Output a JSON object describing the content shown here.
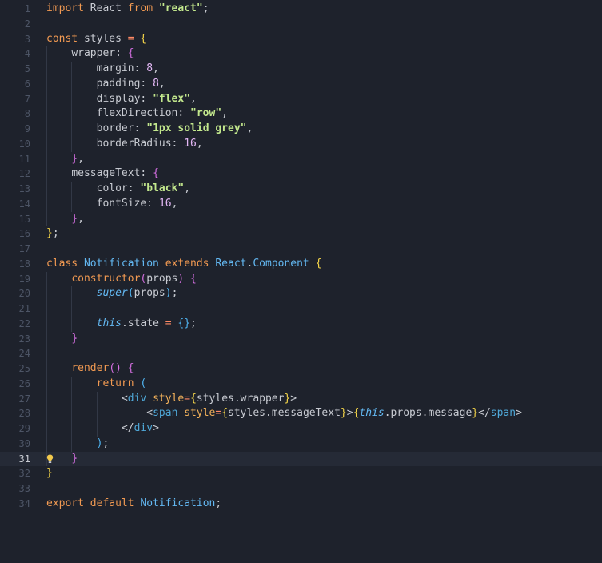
{
  "editor": {
    "current_line": 31,
    "lines": [
      {
        "n": "1",
        "indent": 0,
        "tokens": [
          [
            "kw",
            "import"
          ],
          [
            "plain",
            " React "
          ],
          [
            "kw",
            "from"
          ],
          [
            "plain",
            " "
          ],
          [
            "str",
            "\"react\""
          ],
          [
            "plain",
            ";"
          ]
        ]
      },
      {
        "n": "2",
        "indent": 0,
        "tokens": []
      },
      {
        "n": "3",
        "indent": 0,
        "tokens": [
          [
            "kw",
            "const"
          ],
          [
            "plain",
            " styles "
          ],
          [
            "op",
            "="
          ],
          [
            "plain",
            " "
          ],
          [
            "b1",
            "{"
          ]
        ]
      },
      {
        "n": "4",
        "indent": 1,
        "tokens": [
          [
            "plain",
            "wrapper"
          ],
          [
            "plain",
            ": "
          ],
          [
            "b2",
            "{"
          ]
        ]
      },
      {
        "n": "5",
        "indent": 2,
        "tokens": [
          [
            "plain",
            "margin"
          ],
          [
            "plain",
            ": "
          ],
          [
            "num",
            "8"
          ],
          [
            "plain",
            ","
          ]
        ]
      },
      {
        "n": "6",
        "indent": 2,
        "tokens": [
          [
            "plain",
            "padding"
          ],
          [
            "plain",
            ": "
          ],
          [
            "num",
            "8"
          ],
          [
            "plain",
            ","
          ]
        ]
      },
      {
        "n": "7",
        "indent": 2,
        "tokens": [
          [
            "plain",
            "display"
          ],
          [
            "plain",
            ": "
          ],
          [
            "str",
            "\"flex\""
          ],
          [
            "plain",
            ","
          ]
        ]
      },
      {
        "n": "8",
        "indent": 2,
        "tokens": [
          [
            "plain",
            "flexDirection"
          ],
          [
            "plain",
            ": "
          ],
          [
            "str",
            "\"row\""
          ],
          [
            "plain",
            ","
          ]
        ]
      },
      {
        "n": "9",
        "indent": 2,
        "tokens": [
          [
            "plain",
            "border"
          ],
          [
            "plain",
            ": "
          ],
          [
            "str",
            "\"1px solid grey\""
          ],
          [
            "plain",
            ","
          ]
        ]
      },
      {
        "n": "10",
        "indent": 2,
        "tokens": [
          [
            "plain",
            "borderRadius"
          ],
          [
            "plain",
            ": "
          ],
          [
            "num",
            "16"
          ],
          [
            "plain",
            ","
          ]
        ]
      },
      {
        "n": "11",
        "indent": 1,
        "tokens": [
          [
            "b2",
            "}"
          ],
          [
            "plain",
            ","
          ]
        ]
      },
      {
        "n": "12",
        "indent": 1,
        "tokens": [
          [
            "plain",
            "messageText"
          ],
          [
            "plain",
            ": "
          ],
          [
            "b2",
            "{"
          ]
        ]
      },
      {
        "n": "13",
        "indent": 2,
        "tokens": [
          [
            "plain",
            "color"
          ],
          [
            "plain",
            ": "
          ],
          [
            "str",
            "\"black\""
          ],
          [
            "plain",
            ","
          ]
        ]
      },
      {
        "n": "14",
        "indent": 2,
        "tokens": [
          [
            "plain",
            "fontSize"
          ],
          [
            "plain",
            ": "
          ],
          [
            "num",
            "16"
          ],
          [
            "plain",
            ","
          ]
        ]
      },
      {
        "n": "15",
        "indent": 1,
        "tokens": [
          [
            "b2",
            "}"
          ],
          [
            "plain",
            ","
          ]
        ]
      },
      {
        "n": "16",
        "indent": 0,
        "tokens": [
          [
            "b1",
            "}"
          ],
          [
            "plain",
            ";"
          ]
        ]
      },
      {
        "n": "17",
        "indent": 0,
        "tokens": []
      },
      {
        "n": "18",
        "indent": 0,
        "tokens": [
          [
            "kw",
            "class"
          ],
          [
            "plain",
            " "
          ],
          [
            "cls",
            "Notification"
          ],
          [
            "plain",
            " "
          ],
          [
            "kw",
            "extends"
          ],
          [
            "plain",
            " "
          ],
          [
            "cls",
            "React"
          ],
          [
            "plain",
            "."
          ],
          [
            "cls",
            "Component"
          ],
          [
            "plain",
            " "
          ],
          [
            "b1",
            "{"
          ]
        ]
      },
      {
        "n": "19",
        "indent": 1,
        "tokens": [
          [
            "method",
            "constructor"
          ],
          [
            "b2",
            "("
          ],
          [
            "plain",
            "props"
          ],
          [
            "b2",
            ")"
          ],
          [
            "plain",
            " "
          ],
          [
            "b2",
            "{"
          ]
        ]
      },
      {
        "n": "20",
        "indent": 2,
        "tokens": [
          [
            "ital",
            "super"
          ],
          [
            "b3",
            "("
          ],
          [
            "plain",
            "props"
          ],
          [
            "b3",
            ")"
          ],
          [
            "plain",
            ";"
          ]
        ]
      },
      {
        "n": "21",
        "indent": 2,
        "tokens": []
      },
      {
        "n": "22",
        "indent": 2,
        "tokens": [
          [
            "ital",
            "this"
          ],
          [
            "plain",
            ".state "
          ],
          [
            "op",
            "="
          ],
          [
            "plain",
            " "
          ],
          [
            "b3",
            "{}"
          ],
          [
            "plain",
            ";"
          ]
        ]
      },
      {
        "n": "23",
        "indent": 1,
        "tokens": [
          [
            "b2",
            "}"
          ]
        ]
      },
      {
        "n": "24",
        "indent": 1,
        "tokens": []
      },
      {
        "n": "25",
        "indent": 1,
        "tokens": [
          [
            "method",
            "render"
          ],
          [
            "b2",
            "()"
          ],
          [
            "plain",
            " "
          ],
          [
            "b2",
            "{"
          ]
        ]
      },
      {
        "n": "26",
        "indent": 2,
        "tokens": [
          [
            "kw",
            "return"
          ],
          [
            "plain",
            " "
          ],
          [
            "b3",
            "("
          ]
        ]
      },
      {
        "n": "27",
        "indent": 3,
        "tokens": [
          [
            "punc",
            "<"
          ],
          [
            "tag",
            "div"
          ],
          [
            "plain",
            " "
          ],
          [
            "attr",
            "style"
          ],
          [
            "op",
            "="
          ],
          [
            "b1",
            "{"
          ],
          [
            "plain",
            "styles.wrapper"
          ],
          [
            "b1",
            "}"
          ],
          [
            "punc",
            ">"
          ]
        ]
      },
      {
        "n": "28",
        "indent": 4,
        "tokens": [
          [
            "punc",
            "<"
          ],
          [
            "tag",
            "span"
          ],
          [
            "plain",
            " "
          ],
          [
            "attr",
            "style"
          ],
          [
            "op",
            "="
          ],
          [
            "b1",
            "{"
          ],
          [
            "plain",
            "styles.messageText"
          ],
          [
            "b1",
            "}"
          ],
          [
            "punc",
            ">"
          ],
          [
            "b1",
            "{"
          ],
          [
            "ital",
            "this"
          ],
          [
            "plain",
            ".props.message"
          ],
          [
            "b1",
            "}"
          ],
          [
            "punc",
            "</"
          ],
          [
            "tag",
            "span"
          ],
          [
            "punc",
            ">"
          ]
        ]
      },
      {
        "n": "29",
        "indent": 3,
        "tokens": [
          [
            "punc",
            "</"
          ],
          [
            "tag",
            "div"
          ],
          [
            "punc",
            ">"
          ]
        ]
      },
      {
        "n": "30",
        "indent": 2,
        "tokens": [
          [
            "b3",
            ")"
          ],
          [
            "plain",
            ";"
          ]
        ]
      },
      {
        "n": "31",
        "indent": 1,
        "tokens": [
          [
            "b2",
            "}"
          ]
        ],
        "bulb": true
      },
      {
        "n": "32",
        "indent": 0,
        "tokens": [
          [
            "b1",
            "}"
          ]
        ]
      },
      {
        "n": "33",
        "indent": 0,
        "tokens": []
      },
      {
        "n": "34",
        "indent": 0,
        "tokens": [
          [
            "kw",
            "export"
          ],
          [
            "plain",
            " "
          ],
          [
            "kw",
            "default"
          ],
          [
            "plain",
            " "
          ],
          [
            "cls",
            "Notification"
          ],
          [
            "plain",
            ";"
          ]
        ]
      }
    ]
  },
  "icons": {
    "lightbulb": "lightbulb-icon"
  },
  "colors": {
    "background": "#1e222c",
    "current_line": "#252a36",
    "keyword": "#f29a52",
    "string": "#c3e88d",
    "number": "#e3b7f5",
    "class": "#63b8f2"
  }
}
